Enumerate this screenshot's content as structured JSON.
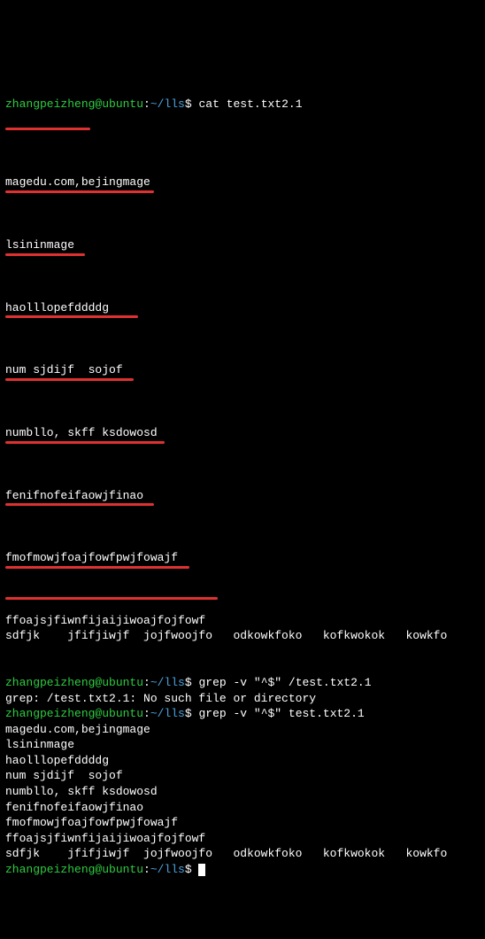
{
  "prompt": {
    "userhost": "zhangpeizheng@ubuntu",
    "sep1": ":",
    "path": "~/lls",
    "sep2": "$"
  },
  "cmd1": "cat test.txt2.1",
  "cat_output": {
    "l1": "magedu.com,bejingmage",
    "l2": "lsininmage",
    "l3": "haolllopefddddg",
    "l4": "num sjdijf  sojof",
    "l5": "numbllo, skff ksdowosd",
    "l6": "fenifnofeifaowjfinao",
    "l7": "fmofmowjfoajfowfpwjfowajf",
    "l8": "ffoajsjfiwnfijaijiwoajfojfowf",
    "l9": "sdfjk    jfifjiwjf  jojfwoojfo   odkowkfoko   kofkwokok   kowkfo"
  },
  "underline_widths": {
    "u0": "96px",
    "u1": "168px",
    "u2": "90px",
    "u3": "150px",
    "u4": "145px",
    "u5": "180px",
    "u6": "168px",
    "u7": "208px",
    "u7b": "240px"
  },
  "cmd2": "grep -v \"^$\" /test.txt2.1",
  "err2": "grep: /test.txt2.1: No such file or directory",
  "cmd3": "grep -v \"^$\" test.txt2.1",
  "grep_output": {
    "g1": "magedu.com,bejingmage",
    "g2": "lsininmage",
    "g3": "haolllopefddddg",
    "g4": "num sjdijf  sojof",
    "g5": "numbllo, skff ksdowosd",
    "g6": "fenifnofeifaowjfinao",
    "g7": "fmofmowjfoajfowfpwjfowajf",
    "g8": "ffoajsjfiwnfijaijiwoajfojfowf",
    "g9": "sdfjk    jfifjiwjf  jojfwoojfo   odkowkfoko   kofkwokok   kowkfo"
  }
}
